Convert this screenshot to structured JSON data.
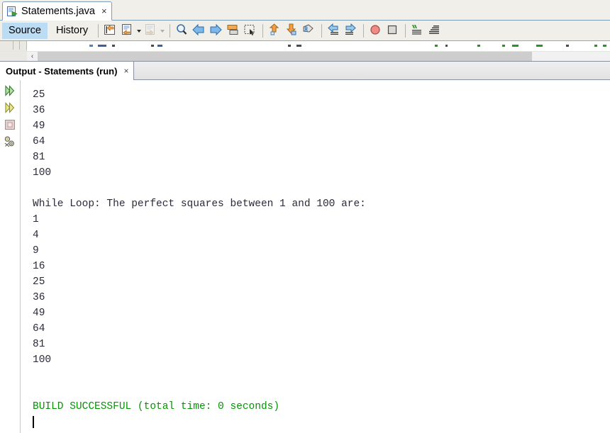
{
  "editor": {
    "tab": {
      "icon": "java-file-icon",
      "title": "Statements.java",
      "close": "×"
    },
    "view_tabs": [
      {
        "label": "Source",
        "active": true
      },
      {
        "label": "History",
        "active": false
      }
    ],
    "toolbar": [
      {
        "name": "toggle-bookmark-icon",
        "label": "Toggle Bookmark"
      },
      {
        "name": "previous-bookmark-icon",
        "label": "Previous Bookmark"
      },
      {
        "name": "next-bookmark-icon",
        "label": "Next Bookmark"
      },
      {
        "name": "find-selection-icon",
        "label": "Find Selection"
      },
      {
        "name": "previous-match-icon",
        "label": "Previous Match"
      },
      {
        "name": "next-match-icon",
        "label": "Next Match"
      },
      {
        "name": "toggle-highlight-icon",
        "label": "Toggle Highlight Search"
      },
      {
        "name": "toggle-rectangular-selection-icon",
        "label": "Toggle Rectangular Selection"
      },
      {
        "name": "previous-bookmark-up-icon",
        "label": "Last Edit"
      },
      {
        "name": "next-error-down-icon",
        "label": "Next Error"
      },
      {
        "name": "inspect-icon",
        "label": "Inspect"
      },
      {
        "name": "shift-left-icon",
        "label": "Shift Line Left"
      },
      {
        "name": "shift-right-icon",
        "label": "Shift Line Right"
      },
      {
        "name": "start-macro-recording-icon",
        "label": "Start Macro Recording"
      },
      {
        "name": "stop-macro-recording-icon",
        "label": "Stop Macro Recording"
      },
      {
        "name": "comment-icon",
        "label": "Comment"
      },
      {
        "name": "uncomment-icon",
        "label": "Uncomment"
      }
    ],
    "scrollbar": {
      "left_arrow": "‹"
    }
  },
  "output": {
    "tab": {
      "title": "Output - Statements (run)",
      "close": "×"
    },
    "gutter_buttons": [
      {
        "name": "rerun-icon",
        "label": "Re-run"
      },
      {
        "name": "rerun-with-different-parameters-icon",
        "label": "Re-run with different parameters"
      },
      {
        "name": "stop-icon",
        "label": "Stop"
      },
      {
        "name": "settings-icon",
        "label": "IDE Log / Settings"
      }
    ],
    "lines": [
      {
        "text": "25",
        "color": "default"
      },
      {
        "text": "36",
        "color": "default"
      },
      {
        "text": "49",
        "color": "default"
      },
      {
        "text": "64",
        "color": "default"
      },
      {
        "text": "81",
        "color": "default"
      },
      {
        "text": "100",
        "color": "default"
      },
      {
        "text": "",
        "color": "default"
      },
      {
        "text": "While Loop: The perfect squares between 1 and 100 are:",
        "color": "default"
      },
      {
        "text": "1",
        "color": "default"
      },
      {
        "text": "4",
        "color": "default"
      },
      {
        "text": "9",
        "color": "default"
      },
      {
        "text": "16",
        "color": "default"
      },
      {
        "text": "25",
        "color": "default"
      },
      {
        "text": "36",
        "color": "default"
      },
      {
        "text": "49",
        "color": "default"
      },
      {
        "text": "64",
        "color": "default"
      },
      {
        "text": "81",
        "color": "default"
      },
      {
        "text": "100",
        "color": "default"
      },
      {
        "text": "",
        "color": "default"
      },
      {
        "text": "",
        "color": "default"
      },
      {
        "text": "BUILD SUCCESSFUL (total time: 0 seconds)",
        "color": "green"
      }
    ]
  },
  "colors": {
    "build_success_green": "#069406",
    "output_text": "#2a2a3a",
    "tab_selected_blue": "#bcdcf4",
    "scrollbar_thumb": "#cdcdcd"
  }
}
